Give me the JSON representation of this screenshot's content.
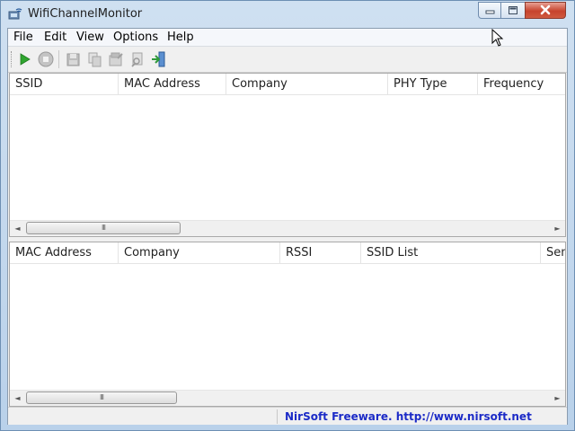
{
  "window": {
    "title": "WifiChannelMonitor",
    "icons": {
      "app": "wifi-monitor-app-icon",
      "minimize": "minimize-icon",
      "maximize": "maximize-icon",
      "close": "close-icon"
    }
  },
  "menu": {
    "items": [
      "File",
      "Edit",
      "View",
      "Options",
      "Help"
    ]
  },
  "toolbar": {
    "buttons": [
      {
        "name": "start-capture-button",
        "icon": "play-icon",
        "enabled": true
      },
      {
        "name": "stop-capture-button",
        "icon": "stop-icon",
        "enabled": false
      },
      {
        "name": "save-button",
        "icon": "save-icon",
        "enabled": false
      },
      {
        "name": "copy-button",
        "icon": "copy-icon",
        "enabled": false
      },
      {
        "name": "properties-button",
        "icon": "properties-icon",
        "enabled": false
      },
      {
        "name": "find-button",
        "icon": "find-icon",
        "enabled": false
      },
      {
        "name": "exit-button",
        "icon": "exit-icon",
        "enabled": true
      }
    ]
  },
  "upper_list": {
    "columns": [
      "SSID",
      "MAC Address",
      "Company",
      "PHY Type",
      "Frequency"
    ],
    "rows": [],
    "scroll_thumb": "III"
  },
  "lower_list": {
    "columns": [
      "MAC Address",
      "Company",
      "RSSI",
      "SSID List",
      "Sent"
    ],
    "rows": [],
    "scroll_thumb": "III"
  },
  "scroll_arrows": {
    "left": "◄",
    "right": "►"
  },
  "statusbar": {
    "link_text": "NirSoft Freeware.  http://www.nirsoft.net"
  },
  "colors": {
    "play": "#2fa52f",
    "link": "#1c2bc7",
    "close_button": "#c7432d"
  }
}
